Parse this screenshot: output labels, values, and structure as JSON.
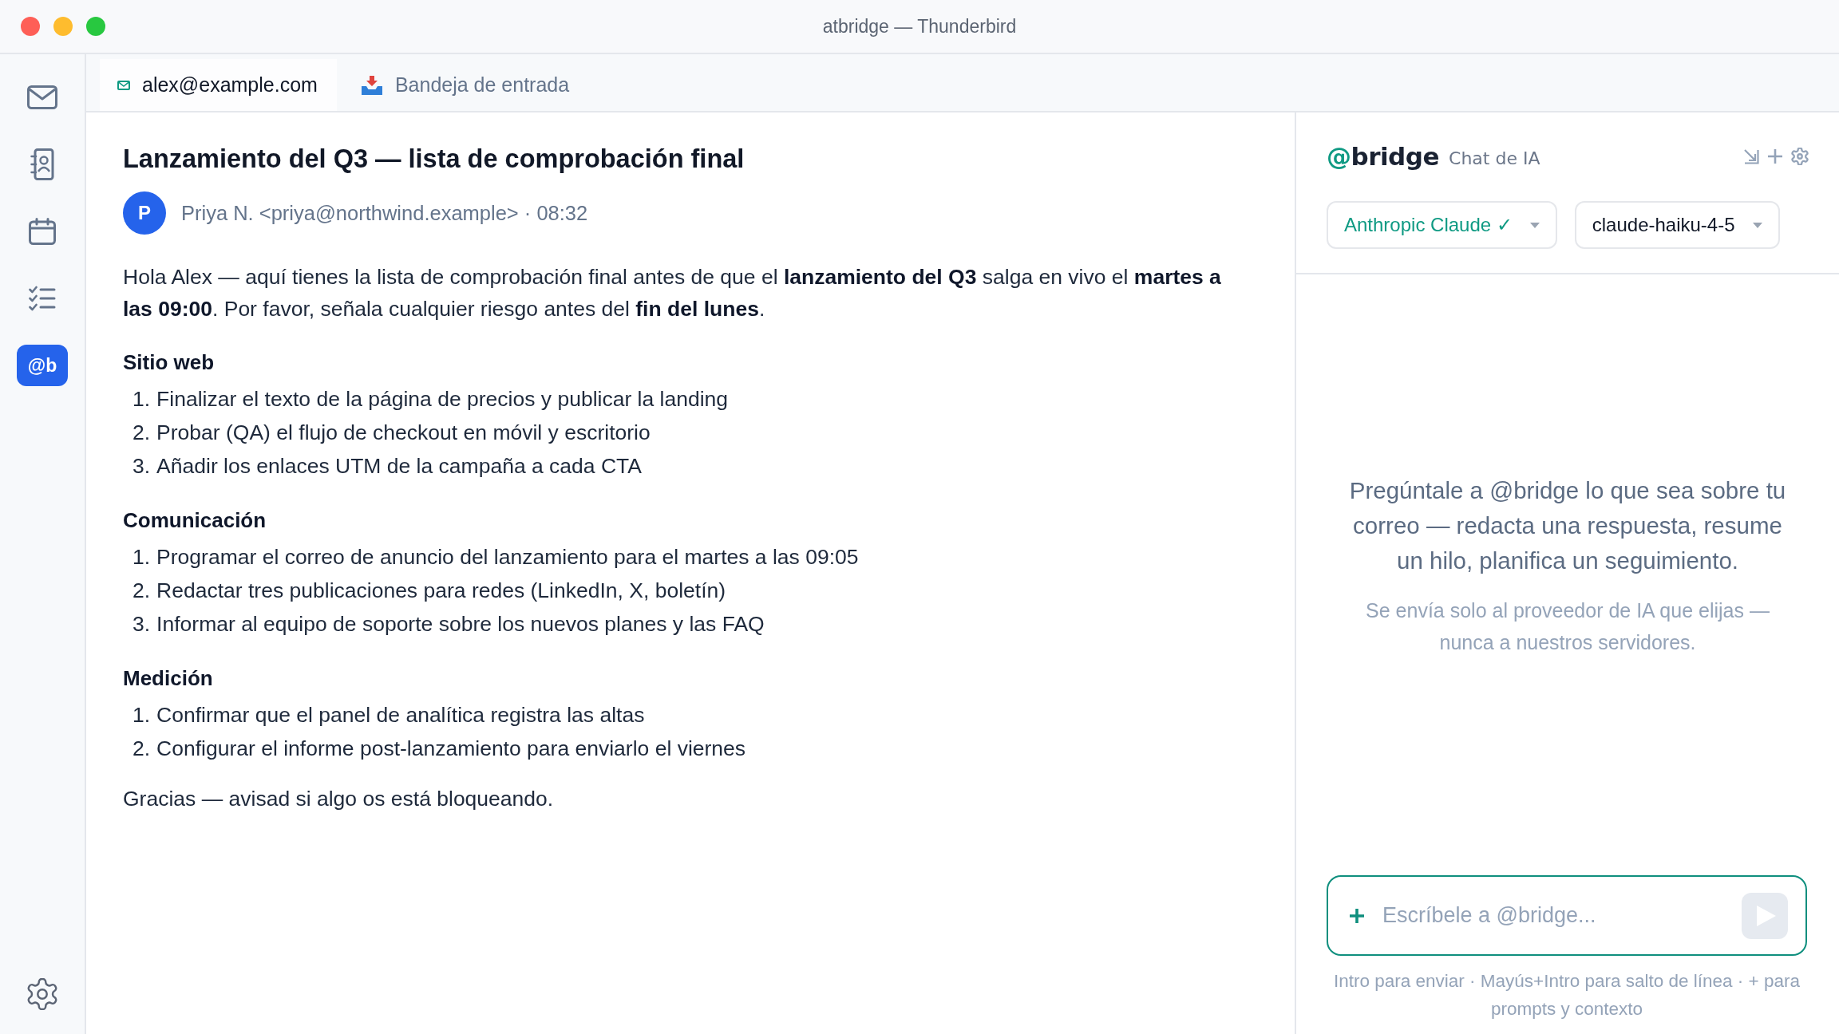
{
  "window": {
    "title": "atbridge — Thunderbird"
  },
  "sidebar": {
    "items": [
      {
        "selected": false
      },
      {
        "selected": false
      },
      {
        "selected": false
      },
      {
        "selected": false
      },
      {
        "label": "@b",
        "selected": true
      }
    ]
  },
  "tabs": [
    {
      "label": "alex@example.com",
      "selected": true
    },
    {
      "label": "Bandeja de entrada",
      "selected": false
    }
  ],
  "message": {
    "subject": "Lanzamiento del Q3 — lista de comprobación final",
    "avatar_initial": "P",
    "sender_line": "Priya N. <priya@northwind.example> · 08:32",
    "intro": "Hola Alex — aquí tienes la lista de comprobación final antes de que el **lanzamiento del Q3** salga en vivo el **martes a las 09:00**. Por favor, señala cualquier riesgo antes del **fin del lunes**.",
    "sections": [
      {
        "heading": "Sitio web",
        "items": [
          {
            "number": "1.",
            "text": "Finalizar el texto de la página de precios y publicar la landing"
          },
          {
            "number": "2.",
            "text": "Probar (QA) el flujo de checkout en móvil y escritorio"
          },
          {
            "number": "3.",
            "text": "Añadir los enlaces UTM de la campaña a cada CTA"
          }
        ]
      },
      {
        "heading": "Comunicación",
        "items": [
          {
            "number": "1.",
            "text": "Programar el correo de anuncio del lanzamiento para el martes a las 09:05"
          },
          {
            "number": "2.",
            "text": "Redactar tres publicaciones para redes (LinkedIn, X, boletín)"
          },
          {
            "number": "3.",
            "text": "Informar al equipo de soporte sobre los nuevos planes y las FAQ"
          }
        ]
      },
      {
        "heading": "Medición",
        "items": [
          {
            "number": "1.",
            "text": "Confirmar que el panel de analítica registra las altas"
          },
          {
            "number": "2.",
            "text": "Configurar el informe post-lanzamiento para enviarlo el viernes"
          }
        ]
      }
    ],
    "closing": "Gracias — avisad si algo os está bloqueando."
  },
  "chat": {
    "brand": {
      "symbol": "@",
      "name": "bridge"
    },
    "subtitle": "Chat de IA",
    "selectors": [
      {
        "value": "Anthropic Claude ✓",
        "connected": true
      },
      {
        "value": "claude-haiku-4-5",
        "connected": false
      }
    ],
    "empty_state": {
      "prompt": "Pregúntale a @bridge lo que sea sobre tu correo — redacta una respuesta, resume un hilo, planifica un seguimiento.",
      "note": "Se envía solo al proveedor de IA que elijas — nunca a nuestros servidores."
    },
    "composer": {
      "placeholder": "Escríbele a @bridge...",
      "send_disabled": true,
      "hint": "Intro para enviar · Mayús+Intro para salto de línea · + para prompts y contexto"
    }
  }
}
